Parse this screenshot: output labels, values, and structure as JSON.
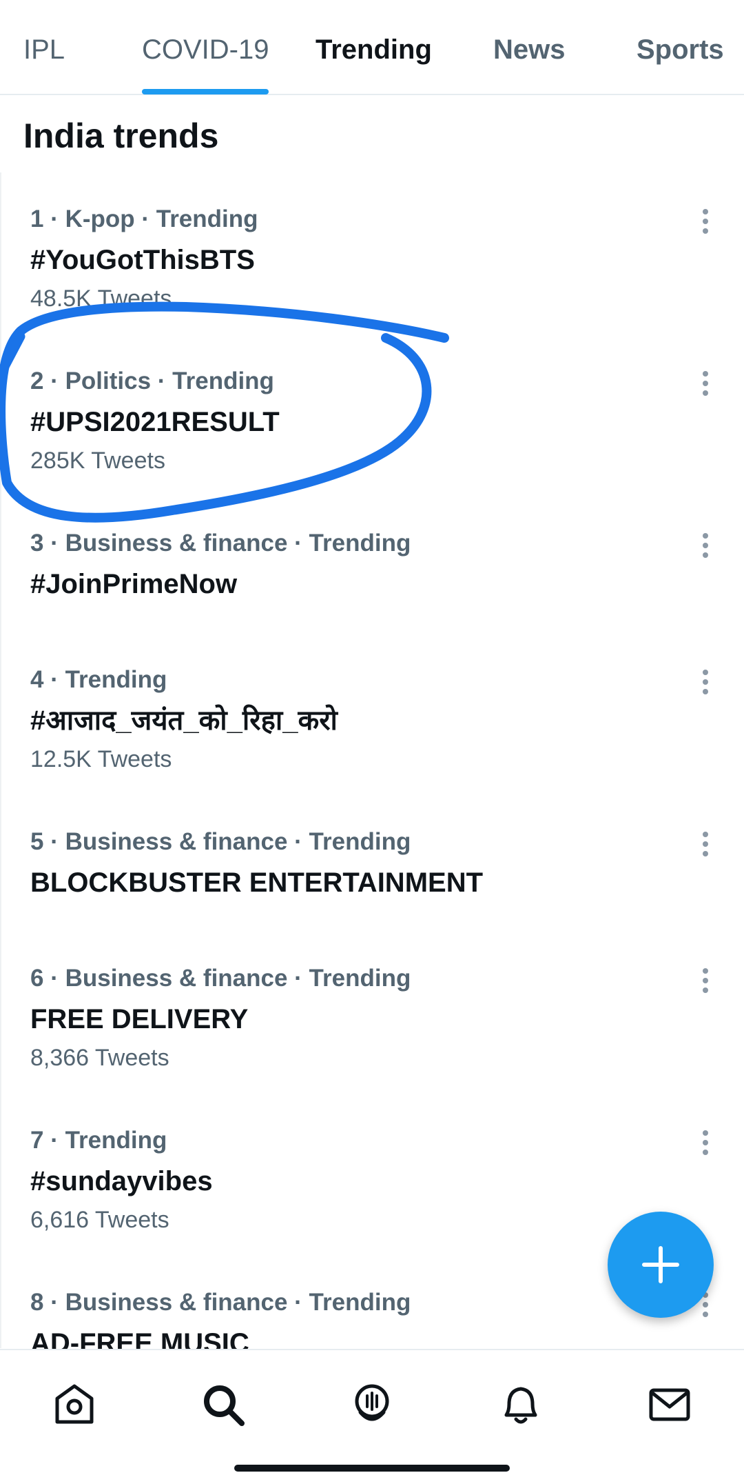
{
  "tabs": [
    {
      "label": "IPL"
    },
    {
      "label": "COVID-19"
    },
    {
      "label": "Trending"
    },
    {
      "label": "News"
    },
    {
      "label": "Sports"
    }
  ],
  "section_title": "India trends",
  "trends": [
    {
      "meta": "1 · K-pop · Trending",
      "title": "#YouGotThisBTS",
      "count": "48.5K Tweets"
    },
    {
      "meta": "2 · Politics · Trending",
      "title": "#UPSI2021RESULT",
      "count": "285K Tweets"
    },
    {
      "meta": "3 · Business & finance · Trending",
      "title": "#JoinPrimeNow",
      "count": ""
    },
    {
      "meta": "4 · Trending",
      "title": "#आजाद_जयंत_को_रिहा_करो",
      "count": "12.5K Tweets"
    },
    {
      "meta": "5 · Business & finance · Trending",
      "title": "BLOCKBUSTER ENTERTAINMENT",
      "count": ""
    },
    {
      "meta": "6 · Business & finance · Trending",
      "title": "FREE DELIVERY",
      "count": "8,366 Tweets"
    },
    {
      "meta": "7 · Trending",
      "title": "#sundayvibes",
      "count": "6,616 Tweets"
    },
    {
      "meta": "8 · Business & finance · Trending",
      "title": "AD-FREE MUSIC",
      "count": ""
    }
  ],
  "fab": {
    "icon": "plus-icon"
  },
  "bottom_nav": [
    {
      "icon": "home-icon"
    },
    {
      "icon": "search-icon"
    },
    {
      "icon": "spaces-microphone-icon"
    },
    {
      "icon": "notifications-bell-icon"
    },
    {
      "icon": "messages-envelope-icon"
    }
  ],
  "colors": {
    "accent": "#1d9bf0",
    "text_primary": "#0f1419",
    "text_secondary": "#536471",
    "annotation_stroke": "#1a73e8"
  }
}
